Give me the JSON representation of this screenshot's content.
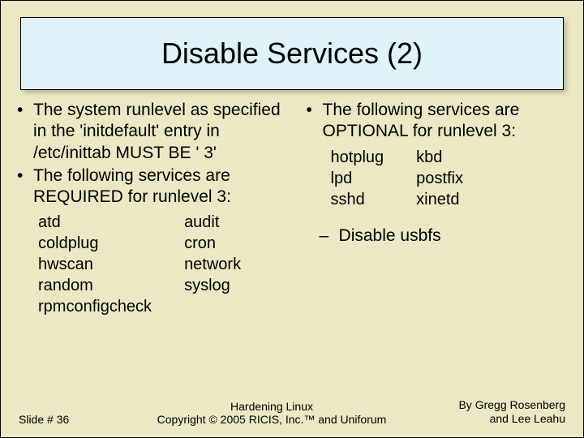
{
  "title": "Disable Services (2)",
  "left": {
    "b1": "The system runlevel as specified in the 'initdefault' entry in /etc/inittab MUST BE ' 3'",
    "b2": "The following services are REQUIRED for runlevel 3:",
    "services_col1": [
      "atd",
      "coldplug",
      "hwscan",
      "random",
      "rpmconfigcheck"
    ],
    "services_col2": [
      "audit",
      "cron",
      "network",
      "syslog"
    ]
  },
  "right": {
    "b1": "The following services are OPTIONAL for runlevel 3:",
    "services_col1": [
      "hotplug",
      "lpd",
      "sshd"
    ],
    "services_col2": [
      "kbd",
      "postfix",
      "xinetd"
    ],
    "dash1": "Disable usbfs"
  },
  "footer": {
    "slide_no": "Slide # 36",
    "center_line1": "Hardening Linux",
    "center_line2": "Copyright © 2005 RICIS, Inc.™ and Uniforum",
    "right_line1": "By Gregg Rosenberg",
    "right_line2": "and Lee Leahu"
  }
}
